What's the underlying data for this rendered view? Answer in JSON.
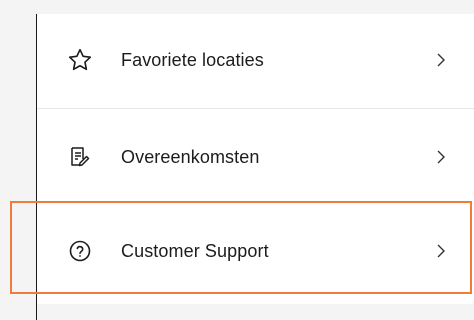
{
  "menu": {
    "items": [
      {
        "label": "Favoriete locaties",
        "icon": "star-outline-icon"
      },
      {
        "label": "Overeenkomsten",
        "icon": "document-edit-icon"
      },
      {
        "label": "Customer Support",
        "icon": "help-circle-icon"
      }
    ]
  },
  "colors": {
    "highlight": "#f07c3c",
    "text": "#1c1c1c",
    "background": "#f4f4f4"
  }
}
